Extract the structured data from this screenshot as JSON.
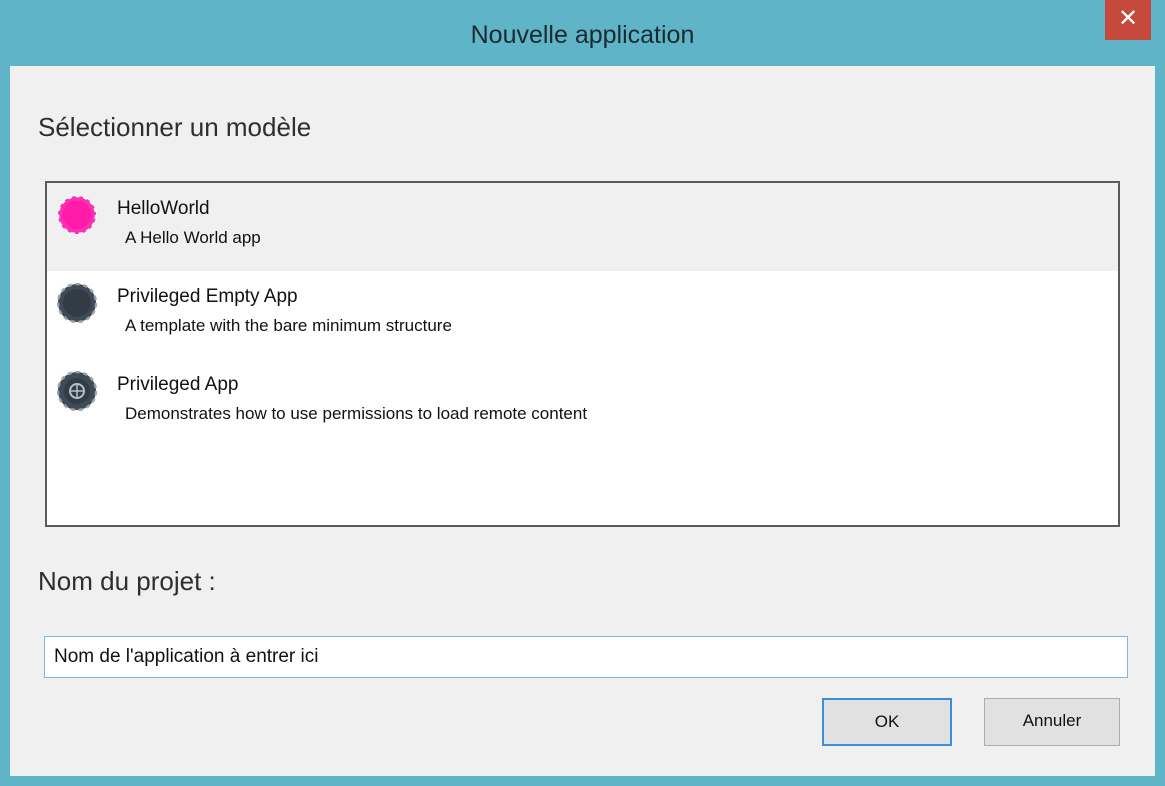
{
  "window": {
    "title": "Nouvelle application",
    "close_glyph": "✕"
  },
  "dialog": {
    "template_heading": "Sélectionner un modèle",
    "templates": [
      {
        "title": "HelloWorld",
        "description": "A Hello World app",
        "icon": "pink-puck-icon",
        "selected": true
      },
      {
        "title": "Privileged Empty App",
        "description": "A template with the bare minimum structure",
        "icon": "dark-puck-icon",
        "selected": false
      },
      {
        "title": "Privileged App",
        "description": "Demonstrates how to use permissions to load remote content",
        "icon": "globe-puck-icon",
        "selected": false
      }
    ],
    "project_name_label": "Nom du projet :",
    "project_name_value": "Nom de l'application à entrer ici",
    "ok_label": "OK",
    "cancel_label": "Annuler"
  },
  "colors": {
    "title_bar": "#5fb4c8",
    "close_button": "#c7493b",
    "selection": "#f0f0f0",
    "focus_border": "#3c8ed8"
  }
}
